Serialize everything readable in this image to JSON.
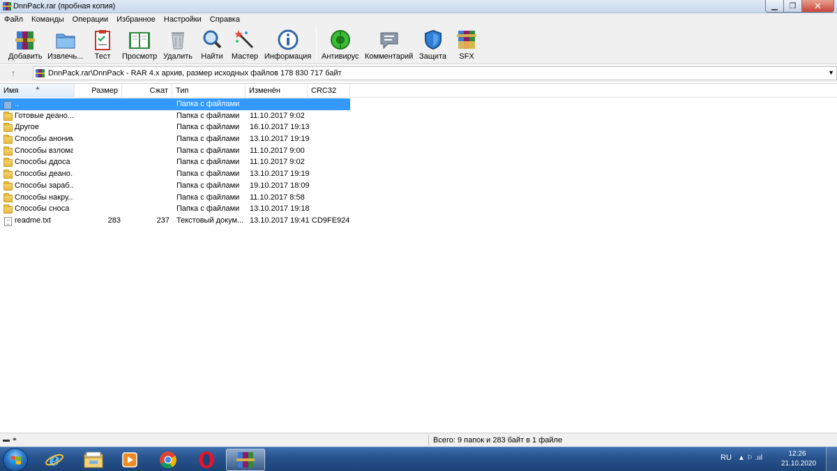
{
  "window": {
    "title": "DnnPack.rar (пробная копия)",
    "controls": {
      "minimize": "▁",
      "maximize": "❐",
      "close": "✕"
    }
  },
  "menu": [
    "Файл",
    "Команды",
    "Операции",
    "Избранное",
    "Настройки",
    "Справка"
  ],
  "toolbar": [
    {
      "label": "Добавить",
      "icon": "add-archive-icon"
    },
    {
      "label": "Извлечь...",
      "icon": "extract-icon"
    },
    {
      "label": "Тест",
      "icon": "test-icon"
    },
    {
      "label": "Просмотр",
      "icon": "view-icon"
    },
    {
      "label": "Удалить",
      "icon": "delete-icon"
    },
    {
      "label": "Найти",
      "icon": "find-icon"
    },
    {
      "label": "Мастер",
      "icon": "wizard-icon"
    },
    {
      "label": "Информация",
      "icon": "info-icon"
    },
    {
      "label": "Антивирус",
      "icon": "antivirus-icon"
    },
    {
      "label": "Комментарий",
      "icon": "comment-icon"
    },
    {
      "label": "Защита",
      "icon": "protect-icon"
    },
    {
      "label": "SFX",
      "icon": "sfx-icon"
    }
  ],
  "path": {
    "up_icon": "↑",
    "text": "DnnPack.rar\\DnnPack - RAR 4.x архив, размер исходных файлов 178 830 717 байт",
    "dropdown": "▼"
  },
  "columns": {
    "name": "Имя",
    "size": "Размер",
    "packed": "Сжат",
    "type": "Тип",
    "modified": "Изменён",
    "crc": "CRC32"
  },
  "files": [
    {
      "name": "..",
      "size": "",
      "packed": "",
      "type": "Папка с файлами",
      "modified": "",
      "crc": "",
      "kind": "up",
      "selected": true
    },
    {
      "name": "Готовые деано...",
      "size": "",
      "packed": "",
      "type": "Папка с файлами",
      "modified": "11.10.2017 9:02",
      "crc": "",
      "kind": "folder"
    },
    {
      "name": "Другое",
      "size": "",
      "packed": "",
      "type": "Папка с файлами",
      "modified": "16.10.2017 19:13",
      "crc": "",
      "kind": "folder"
    },
    {
      "name": "Способы аноним...",
      "size": "",
      "packed": "",
      "type": "Папка с файлами",
      "modified": "13.10.2017 19:19",
      "crc": "",
      "kind": "folder"
    },
    {
      "name": "Способы взлома",
      "size": "",
      "packed": "",
      "type": "Папка с файлами",
      "modified": "11.10.2017 9:00",
      "crc": "",
      "kind": "folder"
    },
    {
      "name": "Способы ддоса",
      "size": "",
      "packed": "",
      "type": "Папка с файлами",
      "modified": "11.10.2017 9:02",
      "crc": "",
      "kind": "folder"
    },
    {
      "name": "Способы деано...",
      "size": "",
      "packed": "",
      "type": "Папка с файлами",
      "modified": "13.10.2017 19:19",
      "crc": "",
      "kind": "folder"
    },
    {
      "name": "Способы зараб...",
      "size": "",
      "packed": "",
      "type": "Папка с файлами",
      "modified": "19.10.2017 18:09",
      "crc": "",
      "kind": "folder"
    },
    {
      "name": "Способы накру...",
      "size": "",
      "packed": "",
      "type": "Папка с файлами",
      "modified": "11.10.2017 8:58",
      "crc": "",
      "kind": "folder"
    },
    {
      "name": "Способы сноса",
      "size": "",
      "packed": "",
      "type": "Папка с файлами",
      "modified": "13.10.2017 19:18",
      "crc": "",
      "kind": "folder"
    },
    {
      "name": "readme.txt",
      "size": "283",
      "packed": "237",
      "type": "Текстовый докум...",
      "modified": "13.10.2017 19:41",
      "crc": "CD9FE924",
      "kind": "file"
    }
  ],
  "status": {
    "drive_icon": "▬ ⚭",
    "text": "Всего: 9 папок и 283 байт в 1 файле"
  },
  "taskbar": {
    "apps": [
      {
        "name": "Internet Explorer",
        "icon": "ie-icon"
      },
      {
        "name": "Explorer",
        "icon": "explorer-icon"
      },
      {
        "name": "Media Player",
        "icon": "media-player-icon"
      },
      {
        "name": "Chrome",
        "icon": "chrome-icon"
      },
      {
        "name": "Opera",
        "icon": "opera-icon"
      },
      {
        "name": "WinRAR",
        "icon": "winrar-icon",
        "active": true
      }
    ],
    "lang": "RU",
    "tray": "▲  ⚐  .ııl",
    "time": "12:26",
    "date": "21.10.2020"
  },
  "colors": {
    "selection": "#3399ff",
    "taskbar": "#26528c",
    "window_bg": "#f0f0f0"
  }
}
